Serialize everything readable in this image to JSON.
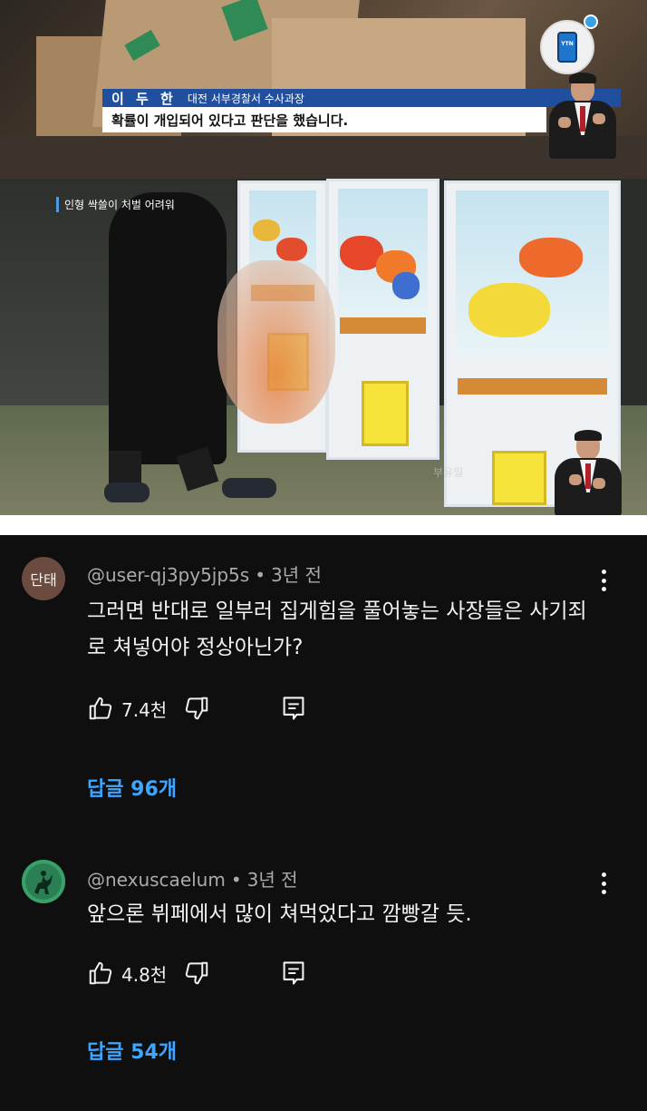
{
  "video": {
    "frame1": {
      "speaker_name": "이 두 한",
      "speaker_title": "대전 서부경찰서 수사과장",
      "caption": "확률이 개입되어 있다고 판단을 했습니다.",
      "channel_badge": "YTN"
    },
    "frame2": {
      "tag": "인형 싹쓸이 처벌 어려워",
      "watermark": "부유일"
    }
  },
  "comments": [
    {
      "avatar_text": "단태",
      "avatar_color": "#6b4a40",
      "author": "@user-qj3py5jp5s",
      "time": "3년 전",
      "text": "그러면 반대로 일부러 집게힘을 풀어놓는 사장들은 사기죄로 쳐넣어야 정상아닌가?",
      "likes": "7.4천",
      "replies": "답글 96개"
    },
    {
      "avatar_text": "",
      "avatar_color": "#2f8a5a",
      "author": "@nexuscaelum",
      "time": "3년 전",
      "text": "앞으론 뷔페에서 많이 쳐먹었다고 깜빵갈 듯.",
      "likes": "4.8천",
      "replies": "답글 54개"
    }
  ],
  "colors": {
    "background": "#0f0f0f",
    "reply_link": "#3ea6ff",
    "meta_text": "#aaaaaa"
  }
}
